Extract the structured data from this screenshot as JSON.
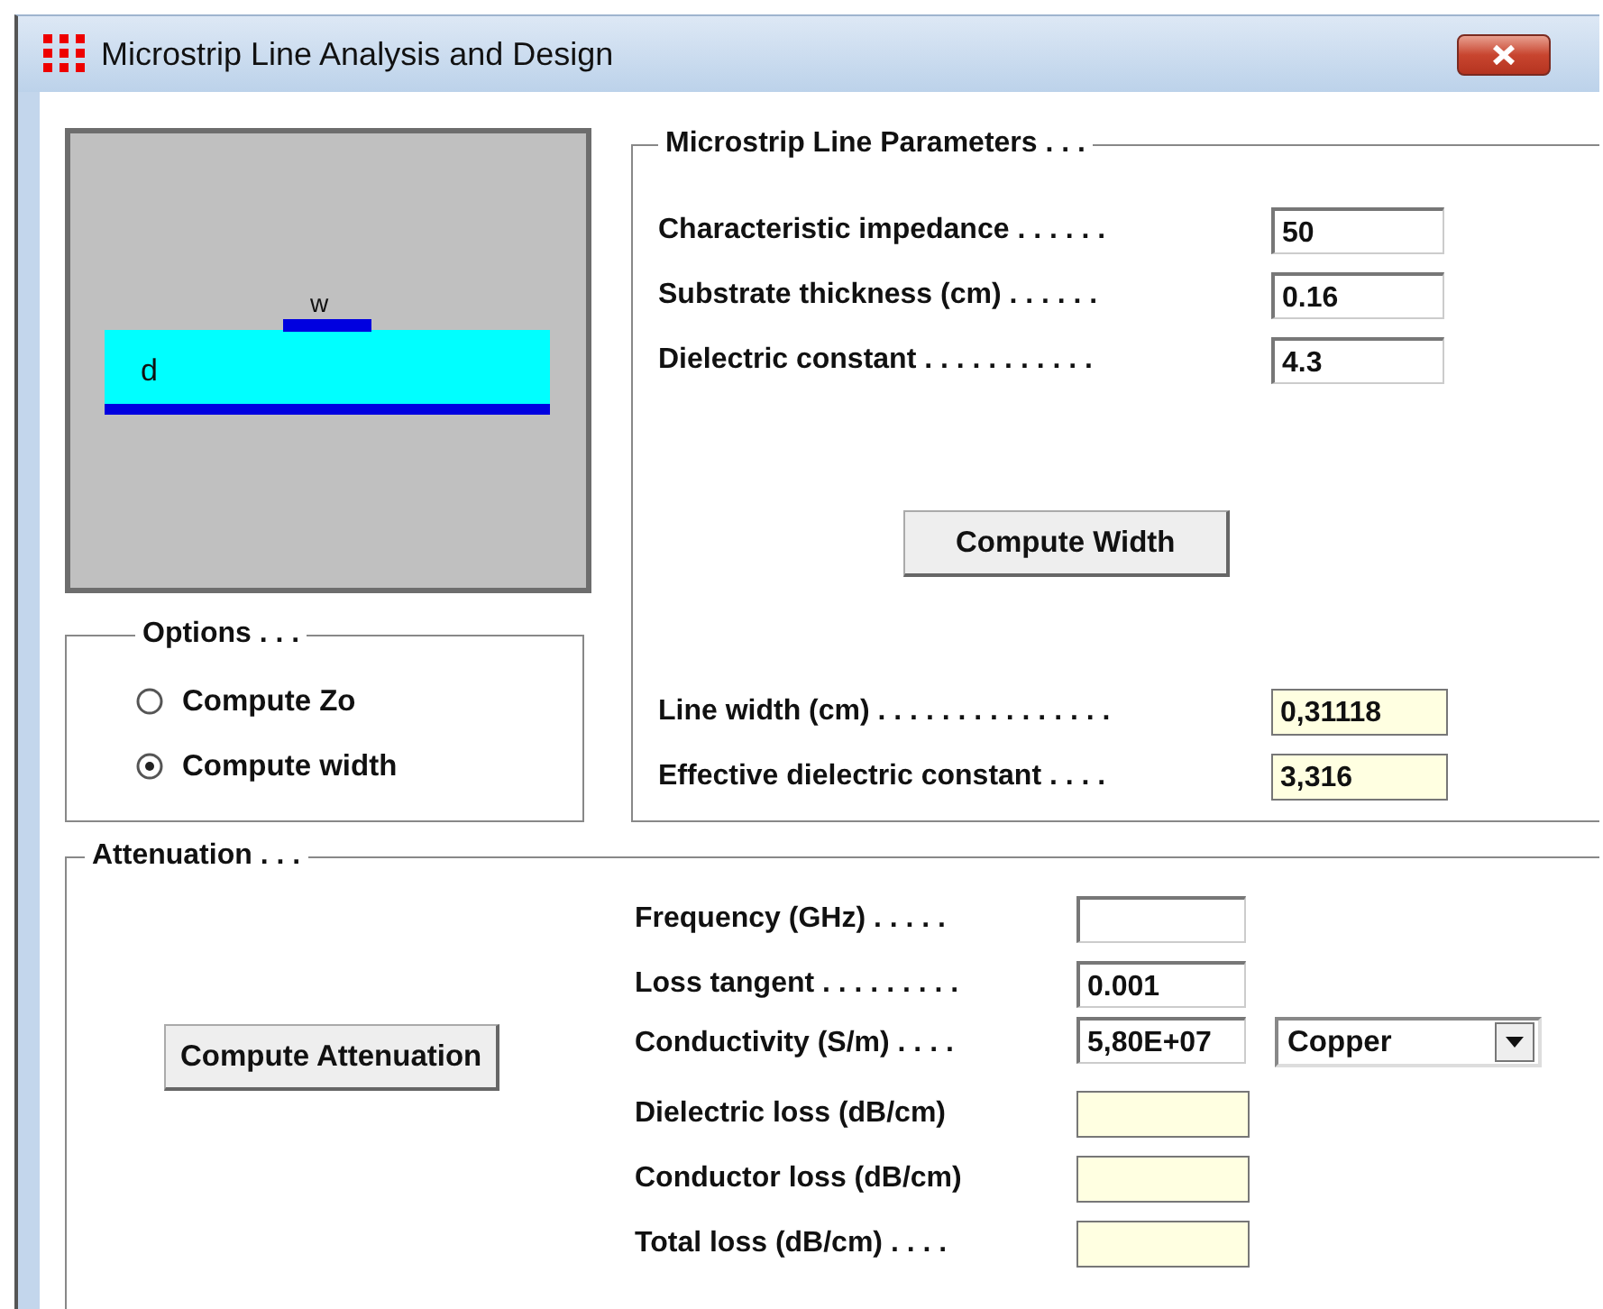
{
  "window": {
    "title": "Microstrip Line Analysis and Design"
  },
  "diagram": {
    "width_label": "w",
    "thickness_label": "d"
  },
  "options": {
    "title": "Options . . .",
    "items": [
      {
        "label": "Compute Zo",
        "selected": false
      },
      {
        "label": "Compute width",
        "selected": true
      }
    ]
  },
  "parameters": {
    "title": "Microstrip Line Parameters . . .",
    "inputs": [
      {
        "label": "Characteristic impedance . . . . . .",
        "value": "50"
      },
      {
        "label": "Substrate thickness (cm) . . . . . .",
        "value": "0.16"
      },
      {
        "label": "Dielectric constant . . . . . . . . . . .",
        "value": "4.3"
      }
    ],
    "button": "Compute Width",
    "outputs": [
      {
        "label": "Line width (cm) . . . . . . . . . . . . . . .",
        "value": "0,31118"
      },
      {
        "label": "Effective dielectric constant . . . .",
        "value": "3,316"
      }
    ]
  },
  "attenuation": {
    "title": "Attenuation . . .",
    "button": "Compute Attenuation",
    "inputs": [
      {
        "label": "Frequency (GHz) . . . . ."
      },
      {
        "label": "Loss tangent . . . . . . . . .",
        "value": "0.001"
      },
      {
        "label": "Conductivity (S/m) . . . .",
        "value": "5,80E+07",
        "material": "Copper"
      }
    ],
    "outputs": [
      {
        "label": "Dielectric loss (dB/cm)"
      },
      {
        "label": "Conductor loss (dB/cm)"
      },
      {
        "label": "Total loss (dB/cm) . . . ."
      }
    ]
  }
}
